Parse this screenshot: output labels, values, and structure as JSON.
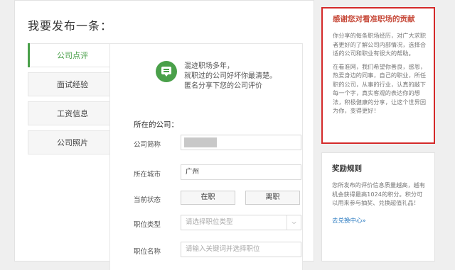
{
  "page": {
    "title": "我要发布一条："
  },
  "tabs": [
    {
      "label": "公司点评",
      "active": true
    },
    {
      "label": "面试经验",
      "active": false
    },
    {
      "label": "工资信息",
      "active": false
    },
    {
      "label": "公司照片",
      "active": false
    }
  ],
  "intro": {
    "icon": "chat-bubble-icon",
    "lines": [
      "混迹职场多年，",
      "就职过的公司好坏你最清楚。",
      "匿名分享下您的公司评价"
    ]
  },
  "form": {
    "section_label": "所在的公司：",
    "company_label": "公司简称",
    "company_value": "",
    "city_label": "所在城市",
    "city_value": "广州",
    "status_label": "当前状态",
    "status_options": [
      "在职",
      "离职"
    ],
    "position_type_label": "职位类型",
    "position_type_placeholder": "请选择职位类型",
    "position_name_label": "职位名称",
    "position_name_placeholder": "请输入关键词并选择职位"
  },
  "thanks": {
    "title": "感谢您对看准职场的贡献",
    "para1": "你分享的每条职场经历，对广大求职者更好的了解公司内部情况，选择合适的公司和职业有很大的帮助。",
    "para2": "在看准网，我们希望你善良，感恩，热爱身边的同事，自己的职业，所任职的公司，从事的行业，认真的敲下每一个字，真实客观的表达你的想法，积极健康的分享，让这个世界因为你，变得更好！"
  },
  "reward": {
    "title": "奖励规则",
    "text": "您所发布的评价信息质量越高，越有机会获得最高1024的积分。积分可以用来参与抽奖、兑换超值礼品！",
    "link": "去兑换中心»"
  },
  "colors": {
    "accent": "#4aa04a",
    "highlight_border": "#d42a2a",
    "thanks_title": "#c74b3b",
    "link": "#2a7ac0"
  }
}
